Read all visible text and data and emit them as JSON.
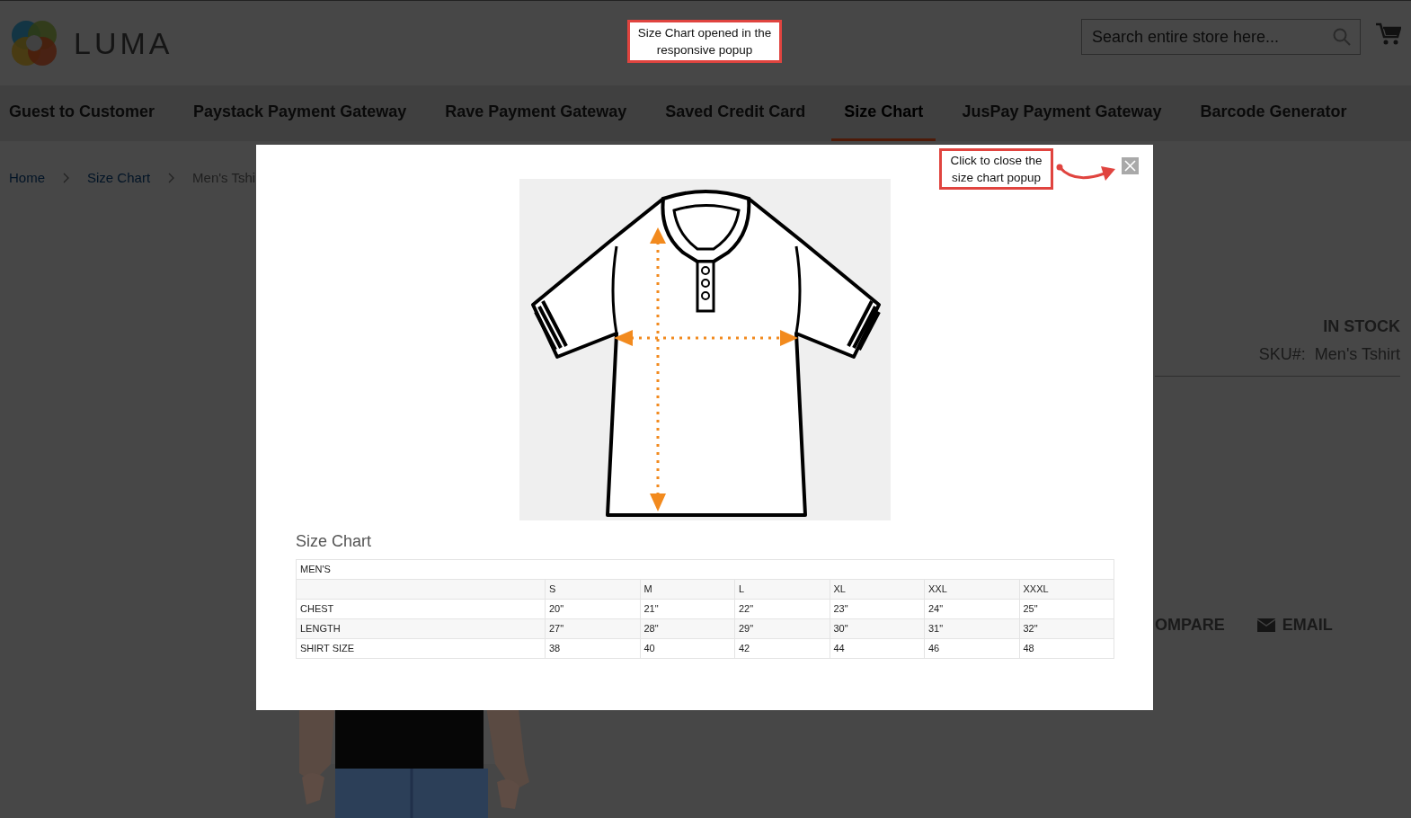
{
  "header": {
    "logo_text": "LUMA",
    "search": {
      "placeholder": "Search entire store here..."
    }
  },
  "nav": [
    {
      "label": "Guest to Customer",
      "selected": false
    },
    {
      "label": "Paystack Payment Gateway",
      "selected": false
    },
    {
      "label": "Rave Payment Gateway",
      "selected": false
    },
    {
      "label": "Saved Credit Card",
      "selected": false
    },
    {
      "label": "Size Chart",
      "selected": true
    },
    {
      "label": "JusPay Payment Gateway",
      "selected": false
    },
    {
      "label": "Barcode Generator",
      "selected": false
    }
  ],
  "breadcrumbs": [
    {
      "label": "Home",
      "kind": "link"
    },
    {
      "label": "Size Chart",
      "kind": "link"
    },
    {
      "label": "Men's Tshi",
      "kind": "current"
    }
  ],
  "product": {
    "stock": "IN STOCK",
    "sku_label": "SKU#:",
    "sku_value": "Men's Tshirt",
    "actions": [
      {
        "label": "OMPARE",
        "kind": "compare"
      },
      {
        "label": "EMAIL",
        "kind": "email"
      }
    ]
  },
  "modal": {
    "title": "Size Chart",
    "table": {
      "caption": "MEN'S",
      "columns": [
        "S",
        "M",
        "L",
        "XL",
        "XXL",
        "XXXL"
      ],
      "rows": [
        {
          "label": "CHEST",
          "values": [
            "20\"",
            "21\"",
            "22\"",
            "23\"",
            "24\"",
            "25\""
          ]
        },
        {
          "label": "LENGTH",
          "values": [
            "27\"",
            "28\"",
            "29\"",
            "30\"",
            "31\"",
            "32\""
          ]
        },
        {
          "label": "SHIRT SIZE",
          "values": [
            "38",
            "40",
            "42",
            "44",
            "46",
            "48"
          ]
        }
      ]
    }
  },
  "annotations": [
    {
      "kind": "top",
      "text": "Size Chart opened in the responsive popup"
    },
    {
      "kind": "close",
      "text": "Click to close the size chart popup"
    }
  ]
}
